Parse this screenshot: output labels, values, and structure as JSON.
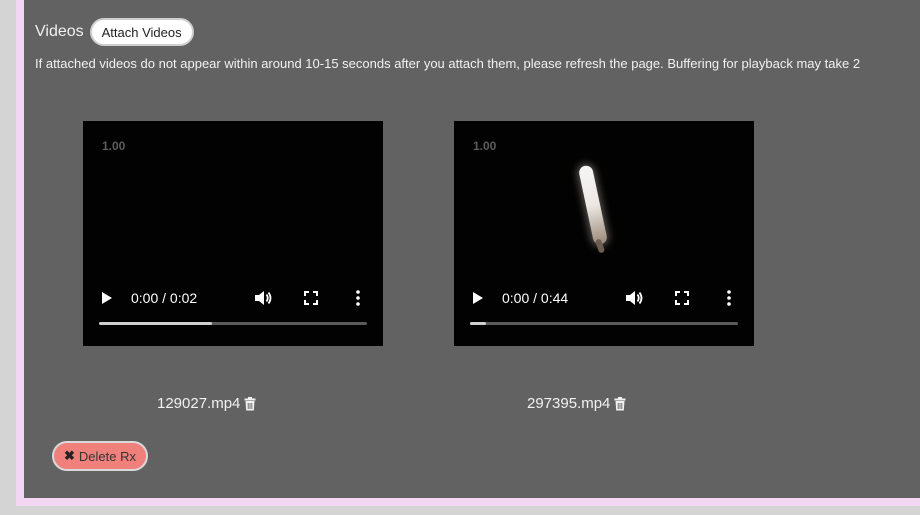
{
  "videos_section": {
    "title": "Videos",
    "attach_label": "Attach Videos",
    "notice": "If attached videos do not appear within around 10-15 seconds after you attach them, please refresh the page. Buffering for playback may take 2"
  },
  "videos": [
    {
      "filename": "129027.mp4",
      "speed": "1.00",
      "time": "0:00 / 0:02",
      "progress": 0.42
    },
    {
      "filename": "297395.mp4",
      "speed": "1.00",
      "time": "0:00 / 0:44",
      "progress": 0.06
    }
  ],
  "actions": {
    "delete_label": "Delete Rx"
  },
  "colors": {
    "panel": "#626262",
    "frame": "#f3d6f1",
    "page": "#d4d4d4",
    "delete_button": "#f0807c"
  },
  "icons": [
    "play-icon",
    "volume-icon",
    "fullscreen-icon",
    "more-vertical-icon",
    "trash-icon",
    "close-icon"
  ]
}
